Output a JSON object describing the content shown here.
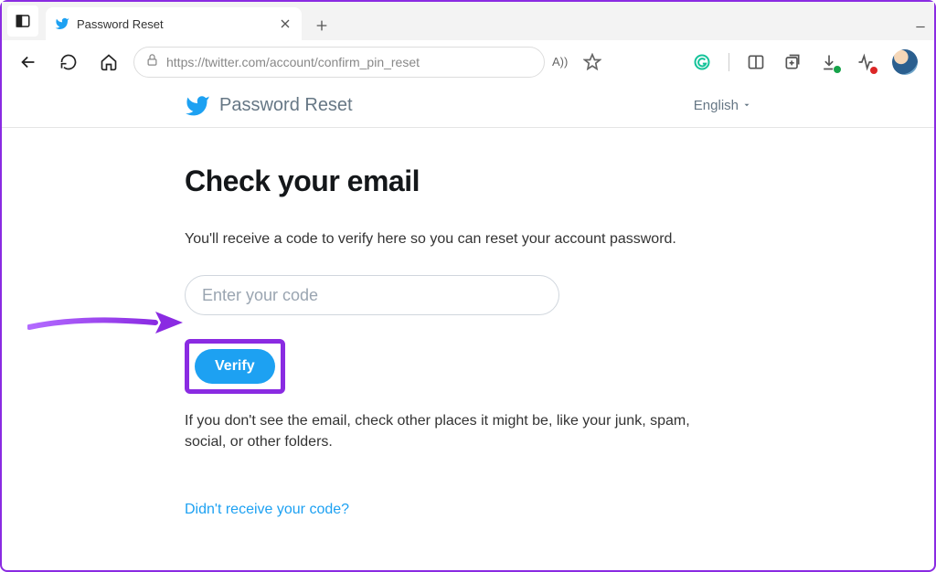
{
  "browser": {
    "tab_title": "Password Reset",
    "url": "https://twitter.com/account/confirm_pin_reset",
    "reader_label": "A))"
  },
  "header": {
    "title": "Password Reset",
    "language": "English"
  },
  "main": {
    "heading": "Check your email",
    "description": "You'll receive a code to verify here so you can reset your account password.",
    "code_placeholder": "Enter your code",
    "verify_label": "Verify",
    "hint": "If you don't see the email, check other places it might be, like your junk, spam, social, or other folders.",
    "resend_link": "Didn't receive your code?"
  }
}
